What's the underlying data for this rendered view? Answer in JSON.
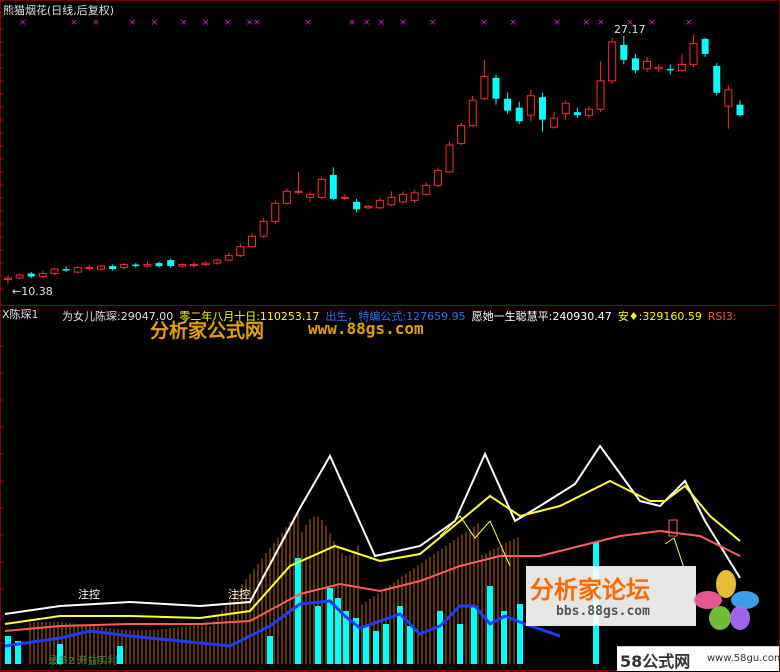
{
  "window": {
    "title": "熊猫烟花(日线,后复权)"
  },
  "price_chart": {
    "high_label": "27.17",
    "low_label": "←10.38",
    "candles": [
      {
        "o": 10.9,
        "c": 11.0,
        "h": 11.2,
        "l": 10.6,
        "up": true
      },
      {
        "o": 11.0,
        "c": 11.2,
        "h": 11.3,
        "l": 10.9,
        "up": true
      },
      {
        "o": 11.3,
        "c": 11.1,
        "h": 11.4,
        "l": 11.0,
        "up": false
      },
      {
        "o": 11.1,
        "c": 11.3,
        "h": 11.5,
        "l": 11.0,
        "up": true
      },
      {
        "o": 11.3,
        "c": 11.6,
        "h": 11.7,
        "l": 11.2,
        "up": true
      },
      {
        "o": 11.6,
        "c": 11.5,
        "h": 11.8,
        "l": 11.4,
        "up": false
      },
      {
        "o": 11.4,
        "c": 11.7,
        "h": 11.8,
        "l": 11.3,
        "up": true
      },
      {
        "o": 11.7,
        "c": 11.7,
        "h": 11.9,
        "l": 11.5,
        "up": true
      },
      {
        "o": 11.6,
        "c": 11.8,
        "h": 11.9,
        "l": 11.5,
        "up": true
      },
      {
        "o": 11.8,
        "c": 11.6,
        "h": 11.9,
        "l": 11.5,
        "up": false
      },
      {
        "o": 11.7,
        "c": 11.9,
        "h": 12.0,
        "l": 11.6,
        "up": true
      },
      {
        "o": 11.9,
        "c": 11.8,
        "h": 12.0,
        "l": 11.7,
        "up": false
      },
      {
        "o": 11.8,
        "c": 11.9,
        "h": 12.1,
        "l": 11.7,
        "up": true
      },
      {
        "o": 12.0,
        "c": 11.8,
        "h": 12.1,
        "l": 11.7,
        "up": false
      },
      {
        "o": 12.2,
        "c": 11.8,
        "h": 12.3,
        "l": 11.7,
        "up": false
      },
      {
        "o": 11.8,
        "c": 11.9,
        "h": 12.0,
        "l": 11.7,
        "up": true
      },
      {
        "o": 11.9,
        "c": 11.9,
        "h": 12.1,
        "l": 11.7,
        "up": true
      },
      {
        "o": 11.9,
        "c": 12.0,
        "h": 12.1,
        "l": 11.8,
        "up": true
      },
      {
        "o": 12.0,
        "c": 12.2,
        "h": 12.3,
        "l": 11.9,
        "up": true
      },
      {
        "o": 12.2,
        "c": 12.5,
        "h": 12.7,
        "l": 12.1,
        "up": true
      },
      {
        "o": 12.5,
        "c": 13.1,
        "h": 13.3,
        "l": 12.4,
        "up": true
      },
      {
        "o": 13.1,
        "c": 13.8,
        "h": 14.0,
        "l": 13.0,
        "up": true
      },
      {
        "o": 13.8,
        "c": 14.8,
        "h": 15.0,
        "l": 13.7,
        "up": true
      },
      {
        "o": 14.8,
        "c": 16.0,
        "h": 16.2,
        "l": 14.6,
        "up": true
      },
      {
        "o": 16.0,
        "c": 16.8,
        "h": 17.0,
        "l": 15.9,
        "up": true
      },
      {
        "o": 16.8,
        "c": 16.8,
        "h": 18.1,
        "l": 16.6,
        "up": true
      },
      {
        "o": 16.4,
        "c": 16.6,
        "h": 16.8,
        "l": 16.1,
        "up": true
      },
      {
        "o": 16.4,
        "c": 17.6,
        "h": 17.8,
        "l": 16.3,
        "up": true
      },
      {
        "o": 17.9,
        "c": 16.3,
        "h": 18.4,
        "l": 16.2,
        "up": false
      },
      {
        "o": 16.4,
        "c": 16.4,
        "h": 16.6,
        "l": 16.2,
        "up": true
      },
      {
        "o": 16.1,
        "c": 15.6,
        "h": 16.3,
        "l": 15.4,
        "up": false
      },
      {
        "o": 15.7,
        "c": 15.8,
        "h": 15.9,
        "l": 15.6,
        "up": true
      },
      {
        "o": 15.7,
        "c": 16.2,
        "h": 16.4,
        "l": 15.6,
        "up": true
      },
      {
        "o": 15.9,
        "c": 16.4,
        "h": 16.8,
        "l": 15.8,
        "up": true
      },
      {
        "o": 16.1,
        "c": 16.6,
        "h": 16.8,
        "l": 16.0,
        "up": true
      },
      {
        "o": 16.2,
        "c": 16.7,
        "h": 16.9,
        "l": 16.0,
        "up": true
      },
      {
        "o": 16.6,
        "c": 17.2,
        "h": 17.4,
        "l": 16.5,
        "up": true
      },
      {
        "o": 17.2,
        "c": 18.2,
        "h": 18.4,
        "l": 17.1,
        "up": true
      },
      {
        "o": 18.1,
        "c": 19.9,
        "h": 20.1,
        "l": 18.0,
        "up": true
      },
      {
        "o": 20.0,
        "c": 21.2,
        "h": 21.4,
        "l": 19.9,
        "up": true
      },
      {
        "o": 21.2,
        "c": 22.9,
        "h": 23.2,
        "l": 21.1,
        "up": true
      },
      {
        "o": 23.0,
        "c": 24.5,
        "h": 25.6,
        "l": 22.9,
        "up": true
      },
      {
        "o": 24.4,
        "c": 23.0,
        "h": 24.6,
        "l": 22.6,
        "up": false
      },
      {
        "o": 23.0,
        "c": 22.2,
        "h": 23.4,
        "l": 22.0,
        "up": false
      },
      {
        "o": 22.4,
        "c": 21.5,
        "h": 22.8,
        "l": 21.3,
        "up": false
      },
      {
        "o": 21.9,
        "c": 23.2,
        "h": 23.6,
        "l": 21.5,
        "up": true
      },
      {
        "o": 23.1,
        "c": 21.6,
        "h": 23.4,
        "l": 20.8,
        "up": false
      },
      {
        "o": 21.1,
        "c": 21.7,
        "h": 22.1,
        "l": 21.0,
        "up": true
      },
      {
        "o": 22.0,
        "c": 22.7,
        "h": 22.9,
        "l": 21.6,
        "up": true
      },
      {
        "o": 22.1,
        "c": 21.9,
        "h": 22.4,
        "l": 21.7,
        "up": false
      },
      {
        "o": 21.9,
        "c": 22.3,
        "h": 22.5,
        "l": 21.7,
        "up": true
      },
      {
        "o": 22.3,
        "c": 24.2,
        "h": 25.5,
        "l": 22.1,
        "up": true
      },
      {
        "o": 24.2,
        "c": 26.8,
        "h": 27.1,
        "l": 24.0,
        "up": true
      },
      {
        "o": 26.6,
        "c": 25.6,
        "h": 27.2,
        "l": 25.3,
        "up": false
      },
      {
        "o": 25.7,
        "c": 24.9,
        "h": 26.0,
        "l": 24.7,
        "up": false
      },
      {
        "o": 25.0,
        "c": 25.5,
        "h": 25.8,
        "l": 24.8,
        "up": true
      },
      {
        "o": 25.0,
        "c": 25.1,
        "h": 25.3,
        "l": 24.8,
        "up": true
      },
      {
        "o": 25.0,
        "c": 24.9,
        "h": 25.3,
        "l": 24.6,
        "up": false
      },
      {
        "o": 24.9,
        "c": 25.3,
        "h": 26.0,
        "l": 24.8,
        "up": true
      },
      {
        "o": 25.3,
        "c": 26.7,
        "h": 27.3,
        "l": 25.1,
        "up": true
      },
      {
        "o": 27.0,
        "c": 26.0,
        "h": 27.1,
        "l": 25.8,
        "up": false
      },
      {
        "o": 25.2,
        "c": 23.4,
        "h": 25.4,
        "l": 23.2,
        "up": false
      },
      {
        "o": 23.6,
        "c": 22.5,
        "h": 23.9,
        "l": 21.0,
        "up": true
      },
      {
        "o": 22.6,
        "c": 21.9,
        "h": 22.9,
        "l": 21.8,
        "up": false
      }
    ],
    "x_marks": [
      2,
      9,
      12,
      17,
      20,
      24,
      27,
      30,
      33,
      34,
      41,
      47,
      49,
      51,
      54,
      58,
      65,
      69,
      75,
      79,
      81,
      85,
      88,
      93
    ],
    "colors": {
      "up": "#ff2a2a",
      "down": "#00ffff",
      "marker": "#ff00ff"
    }
  },
  "indicator": {
    "name_label": "X陈琛1",
    "legend": [
      {
        "text": "为女儿陈琛:29047.00",
        "color": "#e0e0e0"
      },
      {
        "text": "零二年八月十日:110253.17",
        "color": "#ffff00"
      },
      {
        "text": "出生，特编公式:127659.95",
        "color": "#3070ff"
      },
      {
        "text": "愿她一生聪慧平:240930.47",
        "color": "#ffffff"
      },
      {
        "text": "安♦:329160.59",
        "color": "#ffff00"
      },
      {
        "text": "RSI3:",
        "color": "#ff5050"
      }
    ],
    "annotations": [
      "注控",
      "注控"
    ],
    "bottom_label": "最多2 开益实利",
    "colors": {
      "white": "#ffffff",
      "yellow": "#ffff33",
      "red": "#ff5c5c",
      "blue": "#1e3cff",
      "cyan": "#00ffff",
      "orange": "#ff8c1a"
    }
  },
  "watermarks": {
    "top_brand": "分析家公式网",
    "top_url": "www.88gs.com",
    "forum_brand": "分析家论坛",
    "forum_url": "bbs.88gs.com",
    "corner_brand": "58公式网",
    "corner_url": "www.58gu.com"
  }
}
